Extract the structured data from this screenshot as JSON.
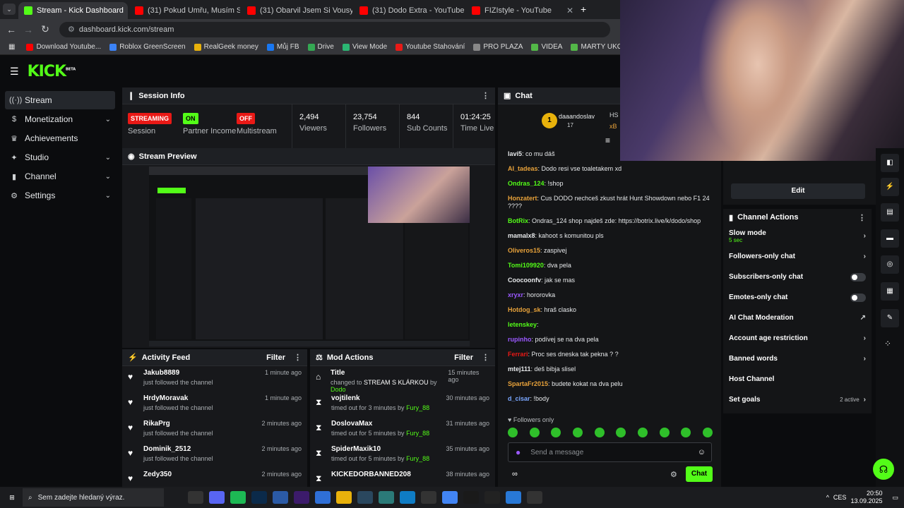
{
  "browser": {
    "tabs": [
      {
        "label": "Stream - Kick Dashboard",
        "icon": "kick-icon",
        "color": "#53fc18",
        "active": true
      },
      {
        "label": "(31) Pokud Umřu, Musím Splnit",
        "icon": "youtube-icon",
        "color": "#ff0000"
      },
      {
        "label": "(31) Obarvil Jsem Si Vousy... - Y",
        "icon": "youtube-icon",
        "color": "#ff0000"
      },
      {
        "label": "(31) Dodo Extra - YouTube",
        "icon": "youtube-icon",
        "color": "#ff0000"
      },
      {
        "label": "FIZIstyle - YouTube",
        "icon": "youtube-icon",
        "color": "#ff0000"
      }
    ],
    "new_tab": "+",
    "url": "dashboard.kick.com/stream",
    "bookmarks": [
      "Download Youtube...",
      "Roblox GreenScreen",
      "RealGeek money",
      "Můj FB",
      "Drive",
      "View Mode",
      "Youtube Stahování",
      "PRO PLAZA",
      "VIDEA",
      "MARTY UKOLY"
    ]
  },
  "brand": {
    "logo": "KICK",
    "beta": "BETA",
    "accent": "#53fc18"
  },
  "sidebar": [
    {
      "label": "Stream",
      "icon": "broadcast-icon",
      "selected": true,
      "chevron": false
    },
    {
      "label": "Monetization",
      "icon": "dollar-icon",
      "chevron": true
    },
    {
      "label": "Achievements",
      "icon": "trophy-icon",
      "chevron": false
    },
    {
      "label": "Studio",
      "icon": "studio-icon",
      "chevron": true
    },
    {
      "label": "Channel",
      "icon": "channel-icon",
      "chevron": true
    },
    {
      "label": "Settings",
      "icon": "gear-icon",
      "chevron": true
    }
  ],
  "session_info": {
    "title": "Session Info",
    "stats": [
      {
        "badge": "STREAMING",
        "badge_color": "#e91916",
        "label": "Session"
      },
      {
        "badge": "ON",
        "badge_color": "#53fc18",
        "label": "Partner Income"
      },
      {
        "badge": "OFF",
        "badge_color": "#e91916",
        "label": "Multistream"
      },
      {
        "value": "2,494",
        "label": "Viewers"
      },
      {
        "value": "23,754",
        "label": "Followers"
      },
      {
        "value": "844",
        "label": "Sub Counts"
      },
      {
        "value": "01:24:25",
        "label": "Time Live"
      }
    ]
  },
  "preview": {
    "title": "Stream Preview"
  },
  "activity": {
    "title": "Activity Feed",
    "filter": "Filter",
    "rows": [
      {
        "name": "Jakub8889",
        "sub": "just followed the channel",
        "time": "1 minute ago"
      },
      {
        "name": "HrdyMoravak",
        "sub": "just followed the channel",
        "time": "1 minute ago"
      },
      {
        "name": "RikaPrg",
        "sub": "just followed the channel",
        "time": "2 minutes ago"
      },
      {
        "name": "Dominik_2512",
        "sub": "just followed the channel",
        "time": "2 minutes ago"
      },
      {
        "name": "Zedy350",
        "sub": "",
        "time": "2 minutes ago"
      }
    ]
  },
  "mod_actions": {
    "title": "Mod Actions",
    "filter": "Filter",
    "rows": [
      {
        "name": "Title",
        "pre": "changed to ",
        "mid": "STREAM S KLÁRKOU",
        "post": " by ",
        "who": "Dodo",
        "time": "15 minutes ago",
        "icon": "tag-icon"
      },
      {
        "name": "vojtilenk",
        "pre": "timed out for 3 minutes by ",
        "who": "Fury_88",
        "time": "30 minutes ago",
        "icon": "hourglass-icon"
      },
      {
        "name": "DoslovaMax",
        "pre": "timed out for 5 minutes by ",
        "who": "Fury_88",
        "time": "31 minutes ago",
        "icon": "hourglass-icon"
      },
      {
        "name": "SpiderMaxik10",
        "pre": "timed out for 5 minutes by ",
        "who": "Fury_88",
        "time": "35 minutes ago",
        "icon": "hourglass-icon"
      },
      {
        "name": "KICKEDORBANNED208",
        "pre": "",
        "who": "",
        "time": "38 minutes ago",
        "icon": "hourglass-icon"
      }
    ]
  },
  "chat": {
    "title": "Chat",
    "pinned_user": "daaandoslav",
    "pinned_count": "17",
    "pinned_tag1": "HS",
    "pinned_tag2": "xB",
    "messages": [
      {
        "user": "lavi5",
        "color": "#e6e8ea",
        "text": "co mu dáš"
      },
      {
        "user": "AI_tadeas",
        "color": "#e8a23a",
        "text": "Dodo resi vse toaletakem xd"
      },
      {
        "user": "Ondras_124",
        "color": "#53fc18",
        "text": "!shop"
      },
      {
        "user": "Honzatert",
        "color": "#e8a23a",
        "text": "Cus DODO nechceš zkust hrát Hunt Showdown nebo F1 24 ????"
      },
      {
        "user": "BotRix",
        "color": "#53fc18",
        "text": "Ondras_124 shop najdeš zde: https://botrix.live/k/dodo/shop"
      },
      {
        "user": "mamalx8",
        "color": "#e6e8ea",
        "text": "kahoot s komunitou pls"
      },
      {
        "user": "Oliveros15",
        "color": "#e8a23a",
        "text": "zaspivej"
      },
      {
        "user": "Tomi109920",
        "color": "#53fc18",
        "text": "dva pela"
      },
      {
        "user": "Coocoonfv",
        "color": "#e6e8ea",
        "text": "jak se mas"
      },
      {
        "user": "xryxr",
        "color": "#9b59ff",
        "text": "hororovka"
      },
      {
        "user": "Hotdog_sk",
        "color": "#e8a23a",
        "text": "hraš clasko"
      },
      {
        "user": "letenskey",
        "color": "#53fc18",
        "text": ""
      },
      {
        "user": "rupinho",
        "color": "#9b59ff",
        "text": "podívej se na dva pela"
      },
      {
        "user": "Ferrari",
        "color": "#e91916",
        "text": "Proc ses dneska tak pekna ? ?"
      },
      {
        "user": "mtej111",
        "color": "#e6e8ea",
        "text": "deš bibja slisel"
      },
      {
        "user": "SpartaFr2015",
        "color": "#e8a23a",
        "text": "budete kokat na dva pelu"
      },
      {
        "user": "d_cisar",
        "color": "#7aa7ff",
        "text": "!body"
      }
    ],
    "followers_only": "Followers only",
    "placeholder": "Send a message",
    "send": "Chat"
  },
  "right": {
    "edit": "Edit",
    "channel_actions": "Channel Actions",
    "rows": [
      {
        "label": "Slow mode",
        "sub": "5 sec",
        "control": "chevron"
      },
      {
        "label": "Followers-only chat",
        "control": "chevron"
      },
      {
        "label": "Subscribers-only chat",
        "control": "toggle"
      },
      {
        "label": "Emotes-only chat",
        "control": "toggle"
      },
      {
        "label": "AI Chat Moderation",
        "control": "external"
      },
      {
        "label": "Account age restriction",
        "control": "chevron"
      },
      {
        "label": "Banned words",
        "control": "chevron"
      },
      {
        "label": "Host Channel",
        "control": "none"
      },
      {
        "label": "Set goals",
        "sub_right": "2 active",
        "control": "chevron"
      }
    ]
  },
  "taskbar": {
    "search": "Sem zadejte hledaný výraz.",
    "time": "20:50",
    "date": "13.09.2025",
    "lang": "CES"
  }
}
